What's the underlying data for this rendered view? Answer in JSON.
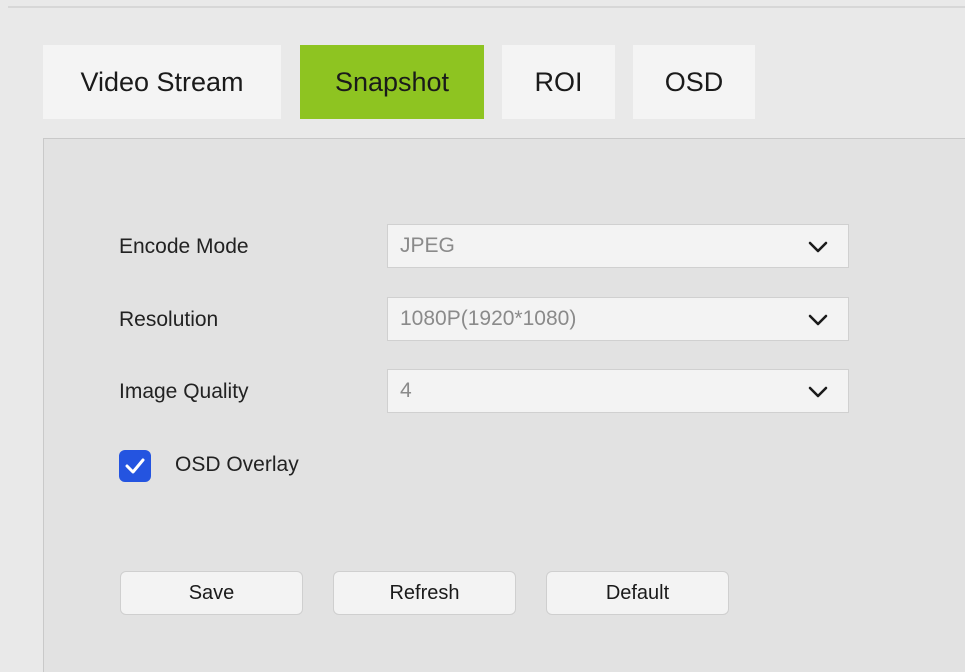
{
  "tabs": [
    {
      "label": "Video Stream",
      "active": false
    },
    {
      "label": "Snapshot",
      "active": true
    },
    {
      "label": "ROI",
      "active": false
    },
    {
      "label": "OSD",
      "active": false
    }
  ],
  "form": {
    "encode_mode": {
      "label": "Encode Mode",
      "value": "JPEG"
    },
    "resolution": {
      "label": "Resolution",
      "value": "1080P(1920*1080)"
    },
    "image_quality": {
      "label": "Image Quality",
      "value": "4"
    },
    "osd_overlay": {
      "label": "OSD Overlay",
      "checked": true
    }
  },
  "buttons": {
    "save": "Save",
    "refresh": "Refresh",
    "default": "Default"
  },
  "colors": {
    "active_tab": "#8ec421",
    "checkbox": "#2454e0"
  },
  "icons": {
    "dropdown": "chevron-down-icon",
    "check": "check-icon"
  }
}
